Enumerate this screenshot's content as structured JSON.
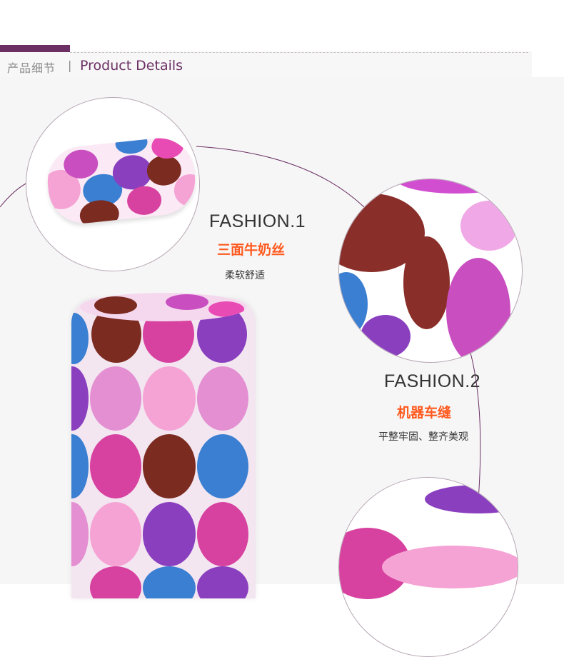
{
  "header": {
    "title_cn": "产品细节",
    "separator": "|",
    "title_en": "Product Details",
    "accent_color": "#6b2f63"
  },
  "features": [
    {
      "title": "FASHION.1",
      "subtitle": "三面牛奶丝",
      "description": "柔软舒适"
    },
    {
      "title": "FASHION.2",
      "subtitle": "机器车缝",
      "description": "平整牢固、整齐美观"
    }
  ],
  "colors": {
    "subtitle": "#ff5a1f",
    "dot_palette": [
      "#e94bb5",
      "#8a3fbf",
      "#3a7fd1",
      "#7b2b20",
      "#f5a3d4",
      "#d7419f"
    ]
  }
}
